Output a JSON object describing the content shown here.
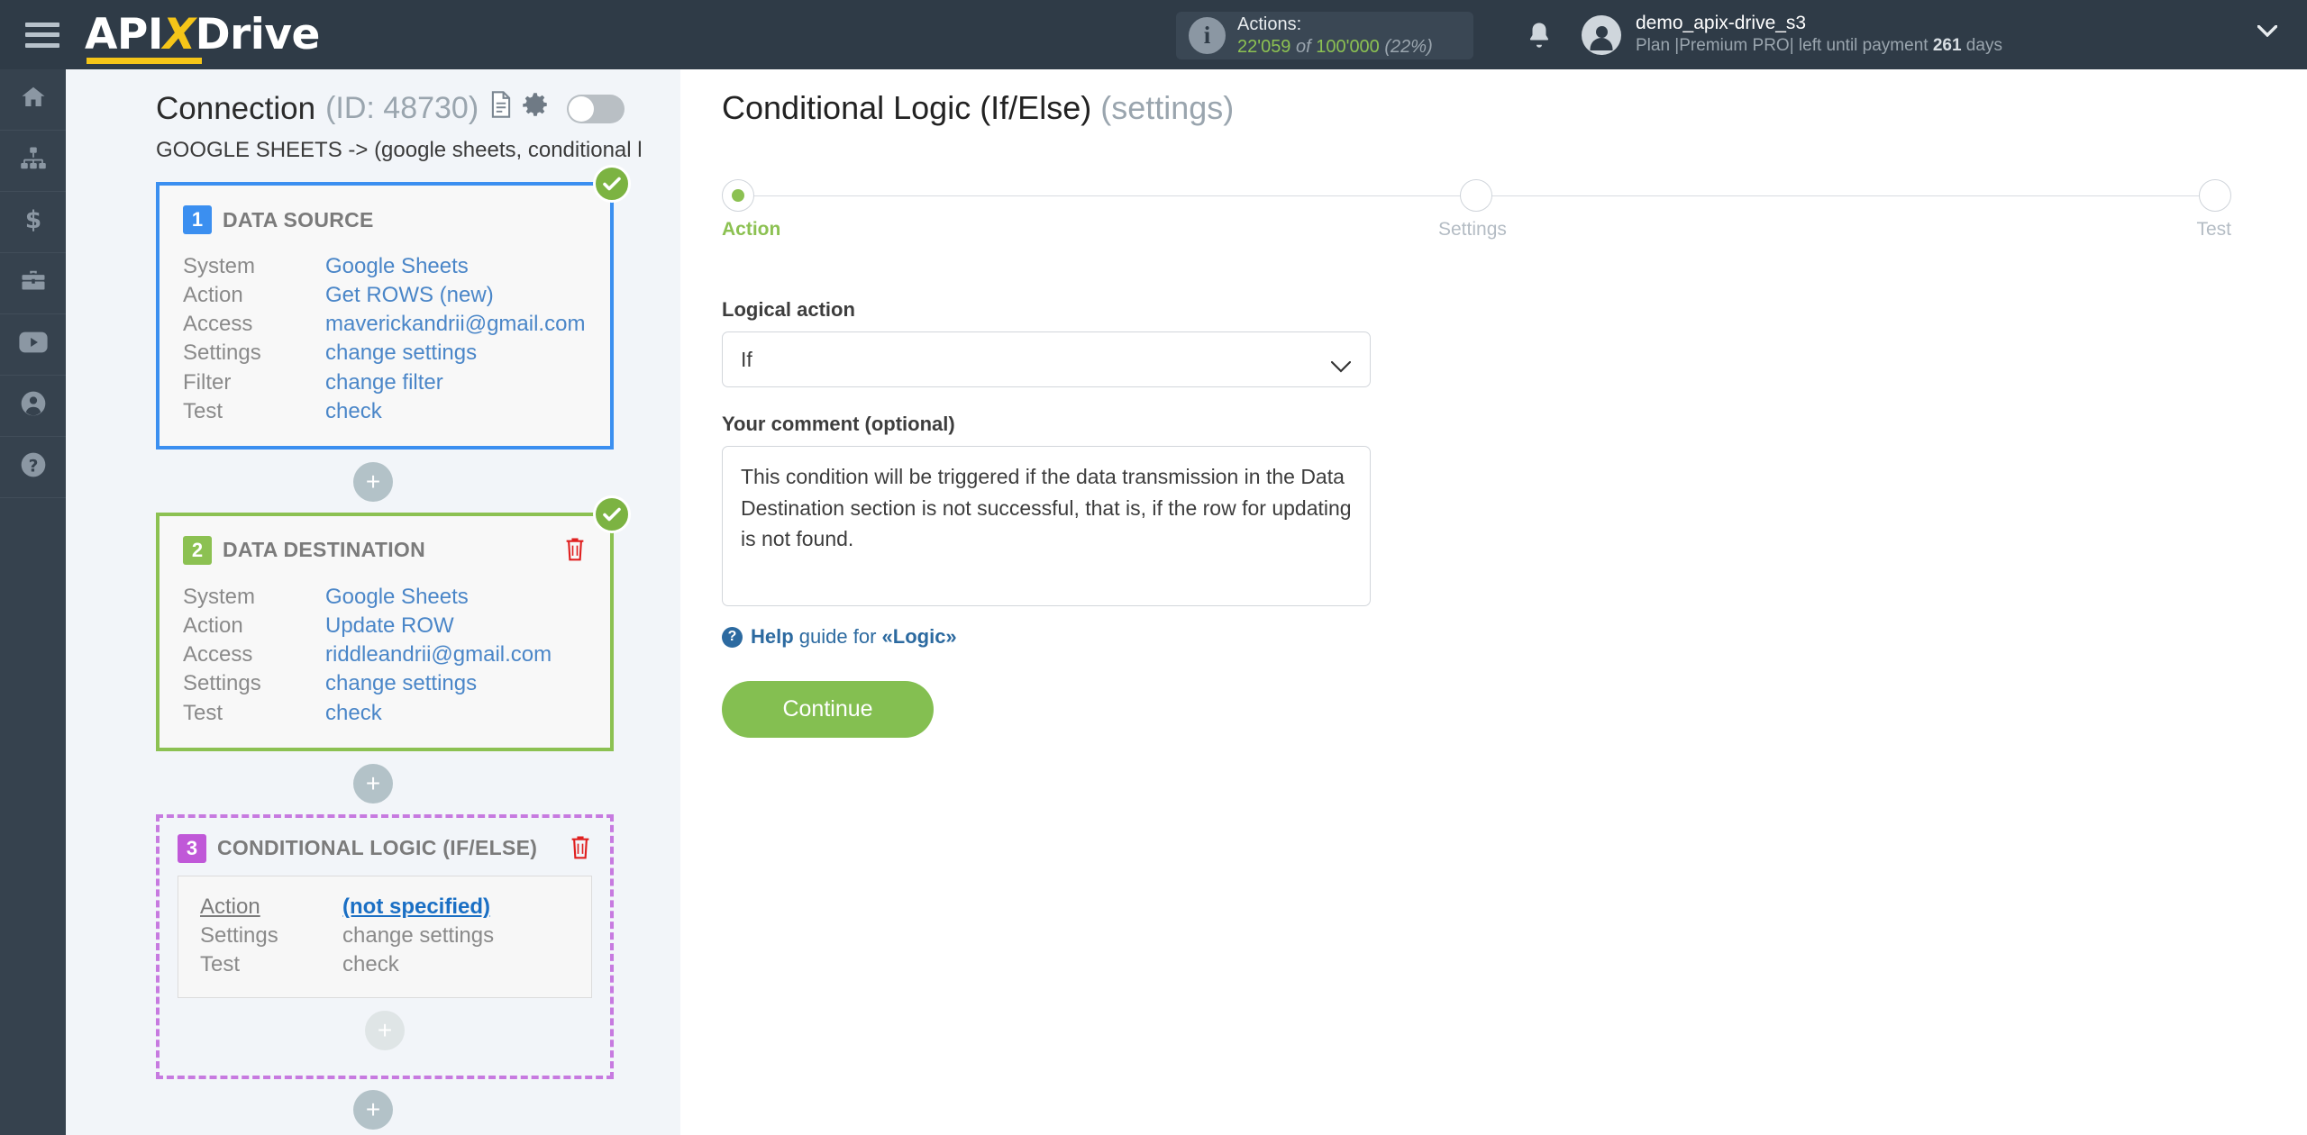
{
  "topbar": {
    "logo": {
      "part1": "API",
      "part2": "X",
      "part3": "Drive"
    },
    "menu_icon": "hamburger-icon",
    "actions": {
      "label": "Actions:",
      "used": "22'059",
      "of": "of",
      "total": "100'000",
      "percent": "(22%)"
    },
    "user": {
      "name": "demo_apix-drive_s3",
      "plan_prefix": "Plan |Premium PRO| left until payment ",
      "days": "261",
      "plan_suffix": " days"
    }
  },
  "rail": {
    "items": [
      {
        "name": "home-icon"
      },
      {
        "name": "connections-icon"
      },
      {
        "name": "billing-icon"
      },
      {
        "name": "briefcase-icon"
      },
      {
        "name": "youtube-icon"
      },
      {
        "name": "account-icon"
      },
      {
        "name": "help-icon"
      }
    ]
  },
  "left_panel": {
    "connection_title": "Connection",
    "connection_id": "(ID: 48730)",
    "connection_subtitle": "GOOGLE SHEETS -> (google sheets, conditional l",
    "toggle_state": "off",
    "cards": [
      {
        "number": "1",
        "title": "DATA SOURCE",
        "status": "ok",
        "rows": [
          {
            "key": "System",
            "value": "Google Sheets"
          },
          {
            "key": "Action",
            "value": "Get ROWS (new)"
          },
          {
            "key": "Access",
            "value": "maverickandrii@gmail.com"
          },
          {
            "key": "Settings",
            "value": "change settings"
          },
          {
            "key": "Filter",
            "value": "change filter"
          },
          {
            "key": "Test",
            "value": "check"
          }
        ]
      },
      {
        "number": "2",
        "title": "DATA DESTINATION",
        "status": "ok",
        "rows": [
          {
            "key": "System",
            "value": "Google Sheets"
          },
          {
            "key": "Action",
            "value": "Update ROW"
          },
          {
            "key": "Access",
            "value": "riddleandrii@gmail.com"
          },
          {
            "key": "Settings",
            "value": "change settings"
          },
          {
            "key": "Test",
            "value": "check"
          }
        ]
      },
      {
        "number": "3",
        "title": "CONDITIONAL LOGIC (IF/ELSE)",
        "status": "none",
        "rows": [
          {
            "key": "Action",
            "value": "(not specified)"
          },
          {
            "key": "Settings",
            "value": "change settings"
          },
          {
            "key": "Test",
            "value": "check"
          }
        ]
      }
    ],
    "add_button_label": "+"
  },
  "content": {
    "page_title": "Conditional Logic (If/Else)",
    "page_title_dim": "(settings)",
    "steps": [
      {
        "label": "Action",
        "state": "active"
      },
      {
        "label": "Settings",
        "state": "inactive"
      },
      {
        "label": "Test",
        "state": "inactive"
      }
    ],
    "form": {
      "logical_action_label": "Logical action",
      "logical_action_value": "If",
      "comment_label": "Your comment (optional)",
      "comment_value": "This condition will be triggered if the data transmission in the Data Destination section is not successful, that is, if the row for updating is not found.",
      "help_bold1": "Help",
      "help_mid": " guide for ",
      "help_bold2": "«Logic»",
      "continue_label": "Continue"
    }
  },
  "colors": {
    "topbar_bg": "#2f3b47",
    "accent_green": "#8cc152",
    "accent_blue": "#3b8ff0",
    "accent_purple": "#c058d8",
    "link_blue": "#4a86c8"
  }
}
